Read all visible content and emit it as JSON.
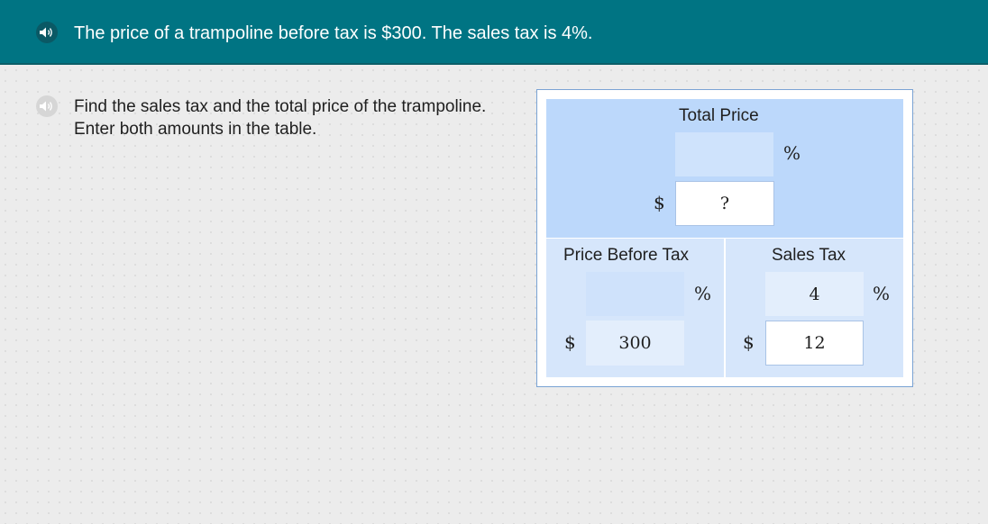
{
  "header": {
    "text": "The price of a trampoline before tax is $300. The sales tax is 4%.",
    "speaker_icon": "speaker-icon"
  },
  "prompt": {
    "text": "Find the sales tax and the total price of the trampoline. Enter both amounts in the table.",
    "speaker_icon": "speaker-icon"
  },
  "table": {
    "total_price": {
      "title": "Total Price",
      "percent_value": "",
      "percent_symbol": "%",
      "dollar_symbol": "$",
      "dollar_value": "?"
    },
    "price_before_tax": {
      "title": "Price Before Tax",
      "percent_value": "",
      "percent_symbol": "%",
      "dollar_symbol": "$",
      "dollar_value": "300"
    },
    "sales_tax": {
      "title": "Sales Tax",
      "percent_value": "4",
      "percent_symbol": "%",
      "dollar_symbol": "$",
      "dollar_value": "12"
    }
  },
  "colors": {
    "header_bg": "#007483",
    "block_bg": "#bcd8fb",
    "sub_block_bg": "#d6e6fb"
  }
}
